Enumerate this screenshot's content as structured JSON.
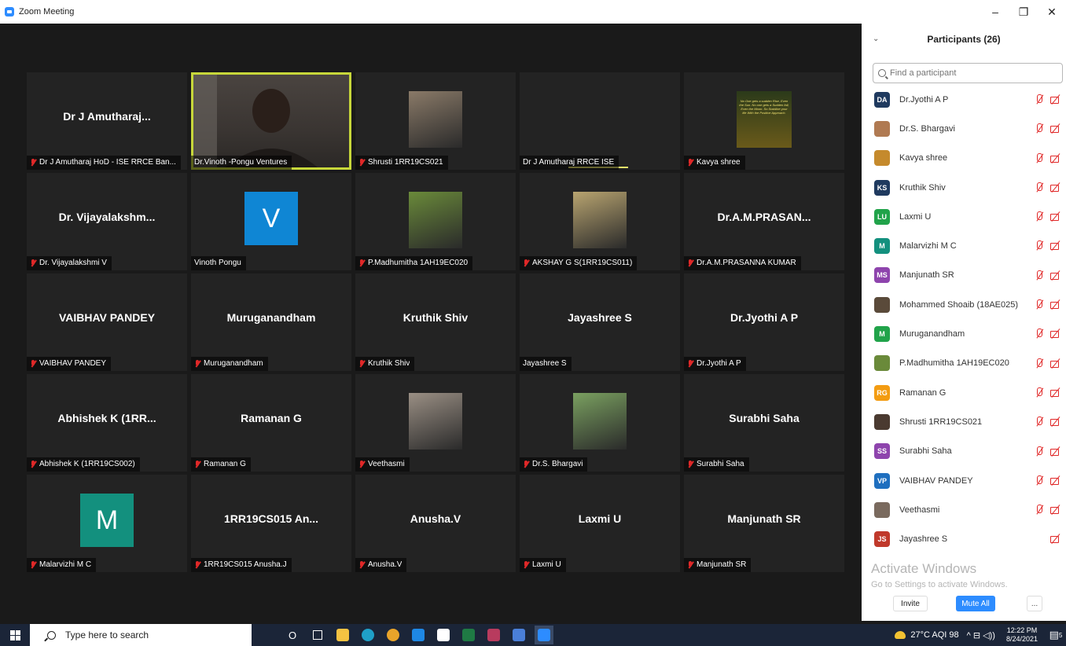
{
  "window": {
    "title": "Zoom Meeting",
    "minimize": "–",
    "maximize": "❐",
    "close": "✕"
  },
  "tiles": [
    {
      "big": "Dr J Amutharaj...",
      "caption": "Dr J Amutharaj HoD - ISE RRCE Ban...",
      "muted": true,
      "kind": "name"
    },
    {
      "big": "",
      "caption": "Dr.Vinoth -Pongu Ventures",
      "muted": false,
      "kind": "video"
    },
    {
      "big": "",
      "caption": "Shrusti 1RR19CS021",
      "muted": true,
      "kind": "photo",
      "photo": "#8a7a68"
    },
    {
      "big": "",
      "caption": "Dr J Amutharaj RRCE ISE",
      "muted": false,
      "kind": "empty"
    },
    {
      "big": "",
      "caption": "Kavya shree",
      "muted": true,
      "kind": "quote",
      "quote": "No One gets a sudden Rise, Even the Sun. No one gets a Sudden fall, Even the Moon. So Stabilize your life With the Positive Approach."
    },
    {
      "big": "Dr. Vijayalakshm...",
      "caption": "Dr. Vijayalakshmi V",
      "muted": true,
      "kind": "name"
    },
    {
      "big": "",
      "caption": "Vinoth Pongu",
      "muted": false,
      "kind": "avatar",
      "letter": "V",
      "color": "#0f86d4"
    },
    {
      "big": "",
      "caption": "P.Madhumitha 1AH19EC020",
      "muted": true,
      "kind": "photo",
      "photo": "#6a8a3a"
    },
    {
      "big": "",
      "caption": "AKSHAY G S(1RR19CS011)",
      "muted": true,
      "kind": "photo",
      "photo": "#b8a470"
    },
    {
      "big": "Dr.A.M.PRASAN...",
      "caption": "Dr.A.M.PRASANNA KUMAR",
      "muted": true,
      "kind": "name"
    },
    {
      "big": "VAIBHAV PANDEY",
      "caption": "VAIBHAV PANDEY",
      "muted": true,
      "kind": "name"
    },
    {
      "big": "Muruganandham",
      "caption": "Muruganandham",
      "muted": true,
      "kind": "name"
    },
    {
      "big": "Kruthik Shiv",
      "caption": "Kruthik Shiv",
      "muted": true,
      "kind": "name"
    },
    {
      "big": "Jayashree S",
      "caption": "Jayashree S",
      "muted": false,
      "kind": "name"
    },
    {
      "big": "Dr.Jyothi A P",
      "caption": "Dr.Jyothi A P",
      "muted": true,
      "kind": "name"
    },
    {
      "big": "Abhishek K (1RR...",
      "caption": "Abhishek K (1RR19CS002)",
      "muted": true,
      "kind": "name"
    },
    {
      "big": "Ramanan G",
      "caption": "Ramanan G",
      "muted": true,
      "kind": "name"
    },
    {
      "big": "",
      "caption": "Veethasmi",
      "muted": true,
      "kind": "photo",
      "photo": "#9a8f84"
    },
    {
      "big": "",
      "caption": "Dr.S. Bhargavi",
      "muted": true,
      "kind": "photo",
      "photo": "#7aa060"
    },
    {
      "big": "Surabhi Saha",
      "caption": "Surabhi Saha",
      "muted": true,
      "kind": "name"
    },
    {
      "big": "",
      "caption": "Malarvizhi M C",
      "muted": true,
      "kind": "avatar",
      "letter": "M",
      "color": "#13907e"
    },
    {
      "big": "1RR19CS015 An...",
      "caption": "1RR19CS015 Anusha.J",
      "muted": true,
      "kind": "name"
    },
    {
      "big": "Anusha.V",
      "caption": "Anusha.V",
      "muted": true,
      "kind": "name"
    },
    {
      "big": "Laxmi U",
      "caption": "Laxmi U",
      "muted": true,
      "kind": "name"
    },
    {
      "big": "Manjunath SR",
      "caption": "Manjunath SR",
      "muted": true,
      "kind": "name"
    }
  ],
  "panel": {
    "title": "Participants (26)",
    "collapse": "⌄",
    "search_placeholder": "Find a participant",
    "participants": [
      {
        "initials": "DA",
        "name": "Dr.Jyothi A P",
        "color": "#1f3a5f",
        "mic": true
      },
      {
        "initials": "",
        "name": "Dr.S. Bhargavi",
        "color": "#b07a52",
        "mic": true
      },
      {
        "initials": "",
        "name": "Kavya shree",
        "color": "#c58a2c",
        "mic": true
      },
      {
        "initials": "KS",
        "name": "Kruthik Shiv",
        "color": "#1f3a5f",
        "mic": true
      },
      {
        "initials": "LU",
        "name": "Laxmi U",
        "color": "#21a34a",
        "mic": true
      },
      {
        "initials": "M",
        "name": "Malarvizhi M C",
        "color": "#13907e",
        "mic": true
      },
      {
        "initials": "MS",
        "name": "Manjunath SR",
        "color": "#8e44ad",
        "mic": true
      },
      {
        "initials": "",
        "name": "Mohammed Shoaib (18AE025)",
        "color": "#5a4a3a",
        "mic": true
      },
      {
        "initials": "M",
        "name": "Muruganandham",
        "color": "#21a34a",
        "mic": true
      },
      {
        "initials": "",
        "name": "P.Madhumitha 1AH19EC020",
        "color": "#6a8a3a",
        "mic": true
      },
      {
        "initials": "RG",
        "name": "Ramanan G",
        "color": "#f39c12",
        "mic": true
      },
      {
        "initials": "",
        "name": "Shrusti 1RR19CS021",
        "color": "#4a3a30",
        "mic": true
      },
      {
        "initials": "SS",
        "name": "Surabhi Saha",
        "color": "#8e44ad",
        "mic": true
      },
      {
        "initials": "VP",
        "name": "VAIBHAV PANDEY",
        "color": "#1f6fbf",
        "mic": true
      },
      {
        "initials": "",
        "name": "Veethasmi",
        "color": "#7a6a5e",
        "mic": true
      },
      {
        "initials": "JS",
        "name": "Jayashree S",
        "color": "#c0392b",
        "mic": false
      }
    ],
    "activate_title": "Activate Windows",
    "activate_sub": "Go to Settings to activate Windows.",
    "invite": "Invite",
    "mute_all": "Mute All",
    "more": "..."
  },
  "taskbar": {
    "search_placeholder": "Type here to search",
    "cortana": "O",
    "weather": "27°C  AQI 98",
    "tray_icons": "^  ⊟  ◁))",
    "time": "12:22 PM",
    "date": "8/24/2021",
    "notif": "5"
  }
}
